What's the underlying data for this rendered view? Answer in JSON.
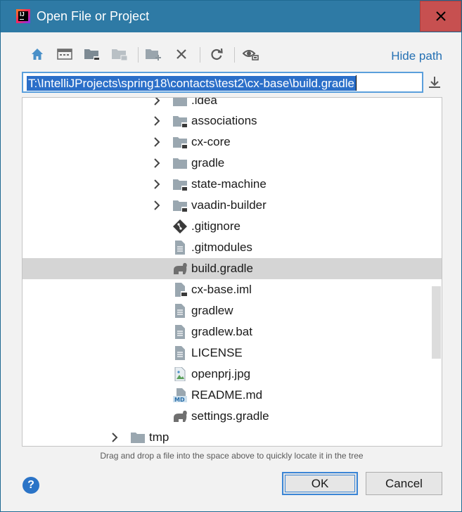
{
  "window": {
    "title": "Open File or Project"
  },
  "toolbar": {
    "buttons": [
      {
        "name": "home-icon"
      },
      {
        "name": "desktop-icon"
      },
      {
        "name": "project-folder-icon"
      },
      {
        "name": "module-folder-icon"
      },
      {
        "name": "new-folder-icon"
      },
      {
        "name": "delete-icon"
      },
      {
        "name": "refresh-icon"
      },
      {
        "name": "show-hidden-icon"
      }
    ],
    "hide_path_label": "Hide path"
  },
  "path": {
    "value": "T:\\IntelliJProjects\\spring18\\contacts\\test2\\cx-base\\build.gradle"
  },
  "tree": {
    "items": [
      {
        "label": ".idea",
        "type": "folder",
        "expandable": true
      },
      {
        "label": "associations",
        "type": "module",
        "expandable": true
      },
      {
        "label": "cx-core",
        "type": "module",
        "expandable": true
      },
      {
        "label": "gradle",
        "type": "folder",
        "expandable": true
      },
      {
        "label": "state-machine",
        "type": "module",
        "expandable": true
      },
      {
        "label": "vaadin-builder",
        "type": "module",
        "expandable": true
      },
      {
        "label": ".gitignore",
        "type": "git",
        "expandable": false
      },
      {
        "label": ".gitmodules",
        "type": "text",
        "expandable": false
      },
      {
        "label": "build.gradle",
        "type": "gradle",
        "expandable": false,
        "selected": true
      },
      {
        "label": "cx-base.iml",
        "type": "iml",
        "expandable": false
      },
      {
        "label": "gradlew",
        "type": "text",
        "expandable": false
      },
      {
        "label": "gradlew.bat",
        "type": "text",
        "expandable": false
      },
      {
        "label": "LICENSE",
        "type": "text",
        "expandable": false
      },
      {
        "label": "openprj.jpg",
        "type": "image",
        "expandable": false
      },
      {
        "label": "README.md",
        "type": "markdown",
        "expandable": false
      },
      {
        "label": "settings.gradle",
        "type": "gradle",
        "expandable": false
      },
      {
        "label": "tmp",
        "type": "folder",
        "expandable": true
      }
    ]
  },
  "hint": "Drag and drop a file into the space above to quickly locate it in the tree",
  "buttons": {
    "ok": "OK",
    "cancel": "Cancel",
    "help": "?"
  },
  "colors": {
    "titlebar": "#2e7aa5",
    "close": "#c75050",
    "selection": "#2b6fc9",
    "link": "#2470b3",
    "folder": "#9aa7b0"
  },
  "icons": {
    "md_badge": "MD"
  }
}
